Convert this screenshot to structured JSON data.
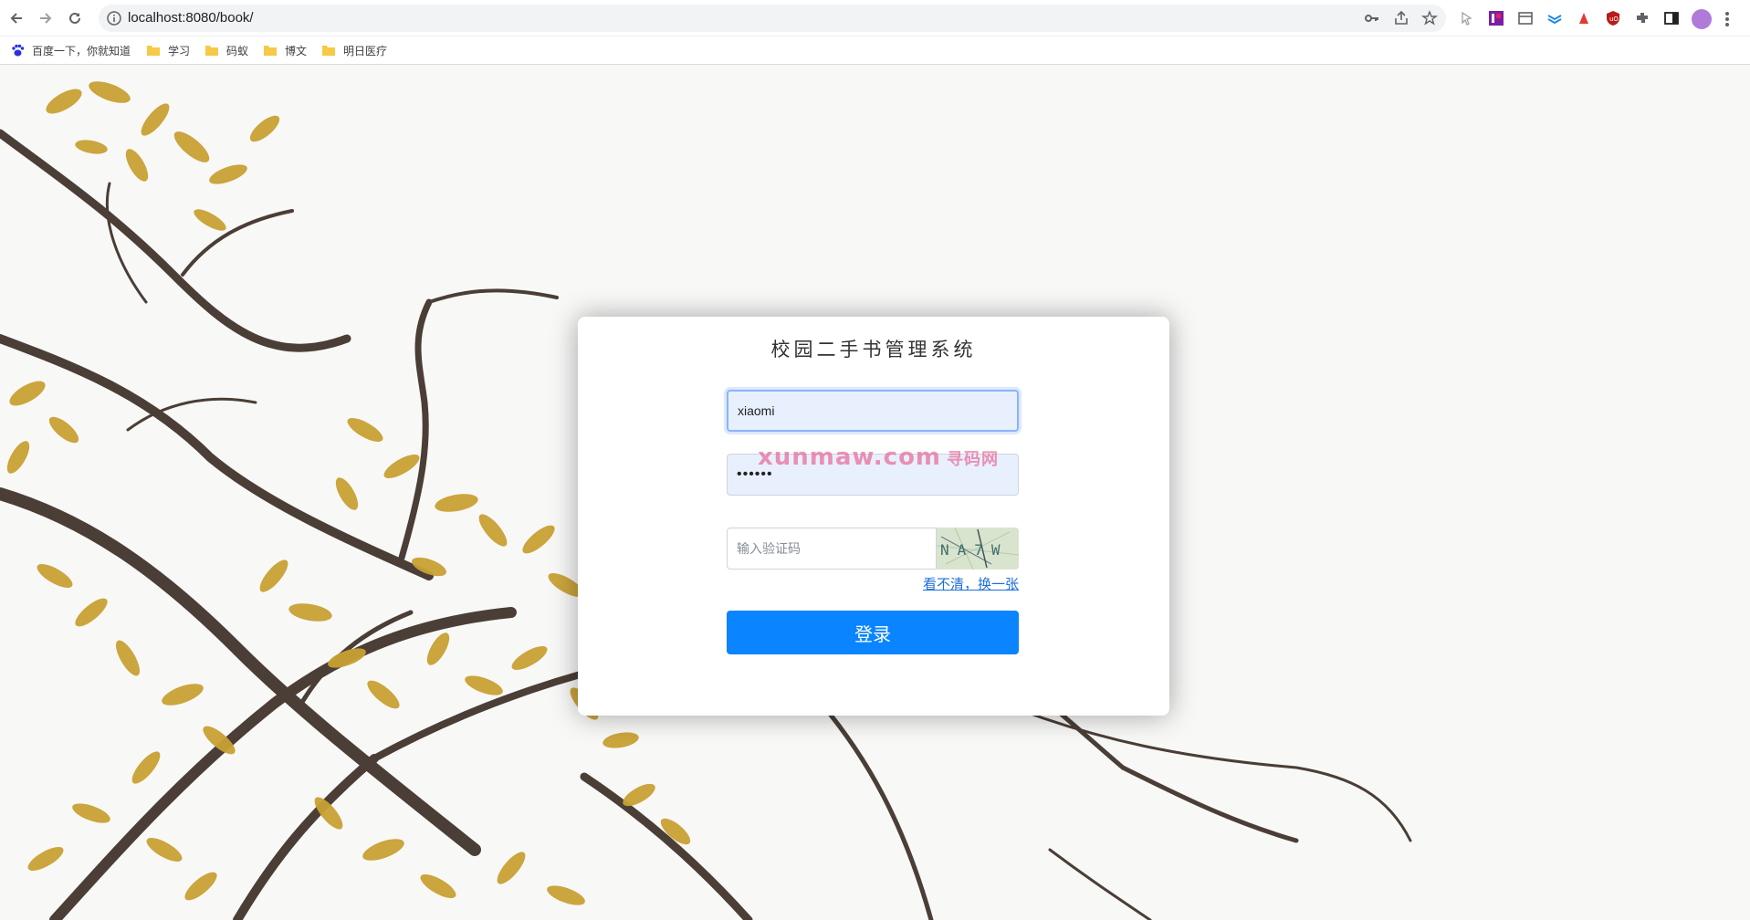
{
  "browser": {
    "url": "localhost:8080/book/",
    "bookmarks": [
      {
        "label": "百度一下，你就知道",
        "icon": "baidu-paw-icon"
      },
      {
        "label": "学习",
        "icon": "folder-icon"
      },
      {
        "label": "码蚁",
        "icon": "folder-icon"
      },
      {
        "label": "博文",
        "icon": "folder-icon"
      },
      {
        "label": "明日医疗",
        "icon": "folder-icon"
      }
    ]
  },
  "login": {
    "title": "校园二手书管理系统",
    "username_value": "xiaomi",
    "password_value": "••••••",
    "captcha_placeholder": "输入验证码",
    "captcha_text": "NA7W",
    "refresh_link": "看不清，换一张",
    "submit_label": "登录"
  },
  "watermark": {
    "text": "xunmaw.com",
    "cn": "寻码网"
  },
  "colors": {
    "primary": "#0a84ff",
    "link": "#1e6fd9",
    "autofill": "#e8f0fe"
  }
}
